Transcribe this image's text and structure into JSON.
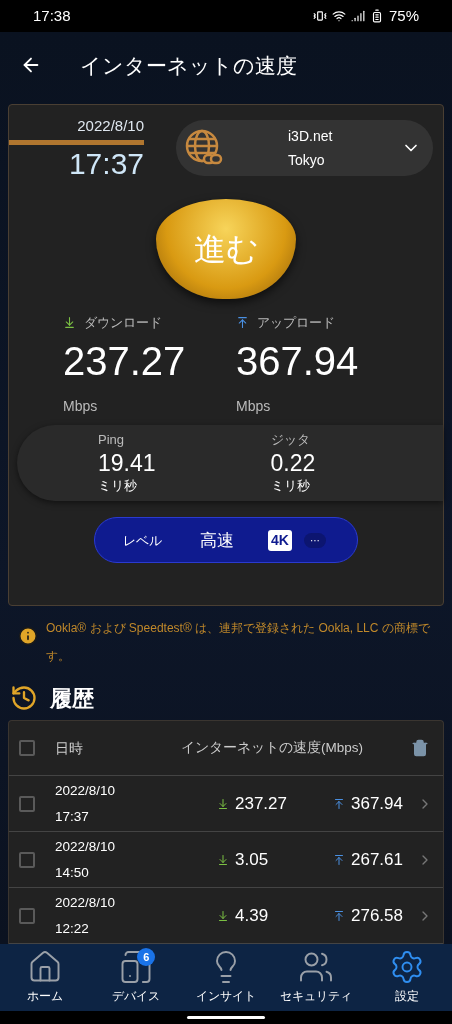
{
  "status_bar": {
    "time": "17:38",
    "battery": "75%"
  },
  "header": {
    "title": "インターネットの速度"
  },
  "test": {
    "date": "2022/8/10",
    "time": "17:37",
    "server": {
      "name": "i3D.net",
      "location": "Tokyo"
    },
    "go_button": "進む",
    "download": {
      "label": "ダウンロード",
      "value": "237.27",
      "unit": "Mbps"
    },
    "upload": {
      "label": "アップロード",
      "value": "367.94",
      "unit": "Mbps"
    },
    "ping": {
      "label": "Ping",
      "value": "19.41",
      "unit": "ミリ秒"
    },
    "jitter": {
      "label": "ジッタ",
      "value": "0.22",
      "unit": "ミリ秒"
    },
    "level": {
      "label": "レベル",
      "value": "高速",
      "badge": "4K",
      "more": "···"
    }
  },
  "notice": "Ookla® および Speedtest® は、連邦で登録された Ookla, LLC の商標です。",
  "history": {
    "title": "履歴",
    "columns": [
      "日時",
      "インターネットの速度(Mbps)"
    ],
    "select_all_checked": false,
    "rows": [
      {
        "date": "2022/8/10",
        "time": "17:37",
        "download": "237.27",
        "upload": "367.94",
        "checked": false
      },
      {
        "date": "2022/8/10",
        "time": "14:50",
        "download": "3.05",
        "upload": "267.61",
        "checked": false
      },
      {
        "date": "2022/8/10",
        "time": "12:22",
        "download": "4.39",
        "upload": "276.58",
        "checked": false
      }
    ]
  },
  "nav": [
    {
      "kind": "home",
      "label": "ホーム",
      "selected": false
    },
    {
      "kind": "devices",
      "label": "デバイス",
      "badge": "6",
      "selected": false
    },
    {
      "kind": "insight",
      "label": "インサイト",
      "selected": false
    },
    {
      "kind": "security",
      "label": "セキュリティ",
      "selected": false
    },
    {
      "kind": "settings",
      "label": "設定",
      "selected": true
    }
  ]
}
